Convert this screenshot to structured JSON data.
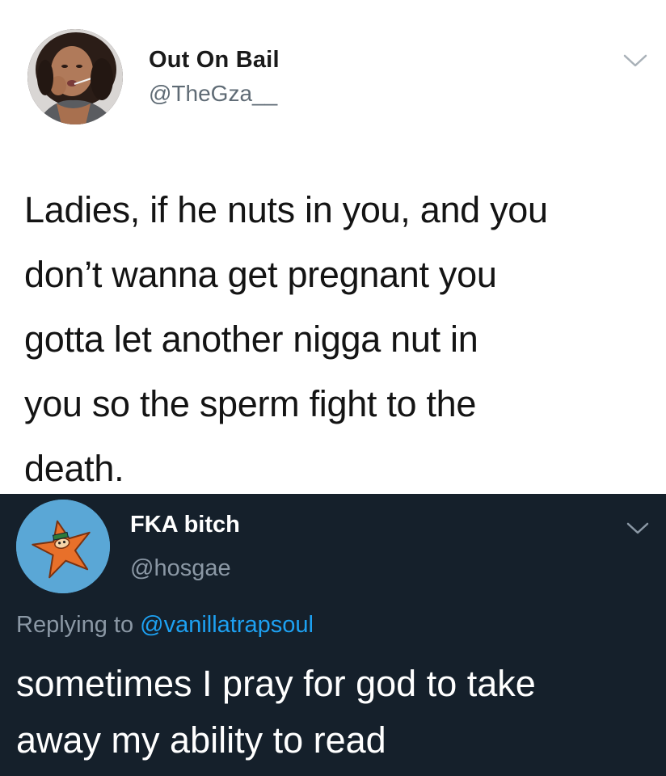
{
  "tweet_top": {
    "display_name": "Out On Bail",
    "handle": "@TheGza__",
    "text_lines": [
      "Ladies, if he nuts in you, and you",
      "don’t wanna get pregnant you",
      "gotta let another nigga nut in",
      "you so the sperm fight to the",
      "death."
    ],
    "menu_icon": "chevron-down-icon"
  },
  "tweet_bottom": {
    "display_name": "FKA bitch",
    "handle": "@hosgae",
    "replying_prefix": "Replying to ",
    "replying_to": "@vanillatrapsoul",
    "text_lines": [
      "sometimes I pray for god to take",
      "away my ability to read"
    ],
    "menu_icon": "chevron-down-icon"
  },
  "colors": {
    "dark_background": "#15202b",
    "link_blue": "#1da1f2",
    "secondary_text_dark": "#8b98a5",
    "secondary_text_light": "#5f6b75"
  }
}
